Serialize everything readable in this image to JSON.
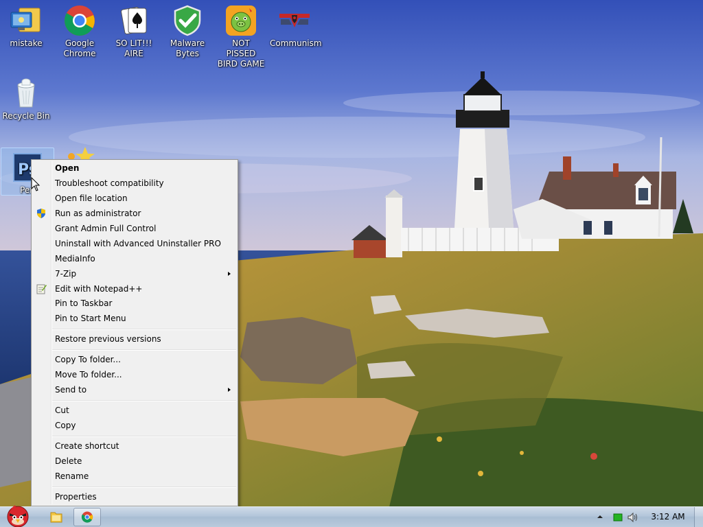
{
  "desktop_icons": [
    {
      "id": "mistake",
      "label": "mistake",
      "icon": "monitor-folder-icon"
    },
    {
      "id": "chrome",
      "label": "Google Chrome",
      "icon": "chrome-icon"
    },
    {
      "id": "solitaire",
      "label": "SO LIT!!! AIRE",
      "icon": "playing-card-icon"
    },
    {
      "id": "malwarebytes",
      "label": "Malware Bytes",
      "icon": "shield-check-icon"
    },
    {
      "id": "pig-game",
      "label": "NOT PISSED BIRD GAME",
      "icon": "green-pig-icon"
    },
    {
      "id": "communism",
      "label": "Communism",
      "icon": "emblem-icon"
    },
    {
      "id": "recycle-bin",
      "label": "Recycle Bin",
      "icon": "recycle-bin-icon"
    },
    {
      "id": "photoshop",
      "label": "Pen",
      "icon": "photoshop-icon"
    }
  ],
  "context_menu": {
    "items": [
      {
        "label": "Open",
        "bold": true
      },
      {
        "label": "Troubleshoot compatibility"
      },
      {
        "label": "Open file location"
      },
      {
        "label": "Run as administrator",
        "icon": "uac-shield-icon"
      },
      {
        "label": "Grant Admin Full Control"
      },
      {
        "label": "Uninstall with Advanced Uninstaller PRO"
      },
      {
        "label": "MediaInfo"
      },
      {
        "label": "7-Zip",
        "submenu": true
      },
      {
        "label": "Edit with Notepad++",
        "icon": "notepad-plus-icon"
      },
      {
        "label": "Pin to Taskbar"
      },
      {
        "label": "Pin to Start Menu"
      },
      {
        "label": "Restore previous versions"
      },
      {
        "label": "Copy To folder..."
      },
      {
        "label": "Move To folder..."
      },
      {
        "label": "Send to",
        "submenu": true
      },
      {
        "label": "Cut"
      },
      {
        "label": "Copy"
      },
      {
        "label": "Create shortcut"
      },
      {
        "label": "Delete"
      },
      {
        "label": "Rename"
      },
      {
        "label": "Properties"
      }
    ]
  },
  "taskbar": {
    "start_icon": "angry-bird-orb-icon",
    "pinned": [
      {
        "name": "explorer",
        "icon": "folder-icon"
      },
      {
        "name": "chrome",
        "icon": "chrome-icon",
        "active": true
      }
    ],
    "tray_icons": [
      "show-hidden-icons-arrow",
      "network-icon",
      "volume-icon"
    ],
    "clock": "3:12 AM"
  }
}
